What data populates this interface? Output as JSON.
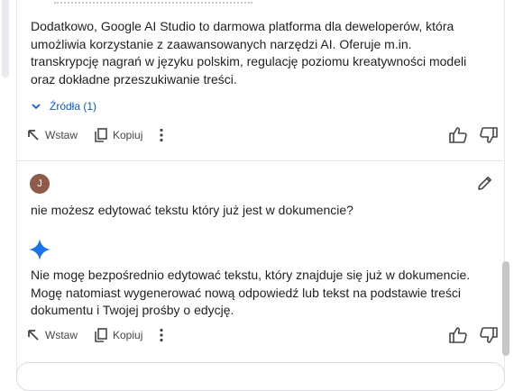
{
  "messages": {
    "first_answer": "Dodatkowo, Google AI Studio to darmowa platforma dla deweloperów, która umożliwia korzystanie z zaawansowanych narzędzi AI. Oferuje m.in. transkrypcję nagrań w języku polskim, regulację poziomu kreatywności modeli oraz dokładne przeszukiwanie treści.",
    "sources_label": "Źródła (1)",
    "user_avatar_initial": "J",
    "user_question": "nie możesz edytować tekstu który już jest w dokumencie?",
    "second_answer": "Nie mogę bezpośrednio edytować tekstu, który znajduje się już w dokumencie. Mogę natomiast wygenerować nową odpowiedź lub tekst na podstawie treści dokumentu i Twojej prośby o edycję."
  },
  "actions": {
    "insert_label": "Wstaw",
    "copy_label": "Kopiuj"
  },
  "colors": {
    "accent_blue": "#0b57d0",
    "avatar_bg": "#8d5b48",
    "gemini_blue": "#1a73e8"
  }
}
